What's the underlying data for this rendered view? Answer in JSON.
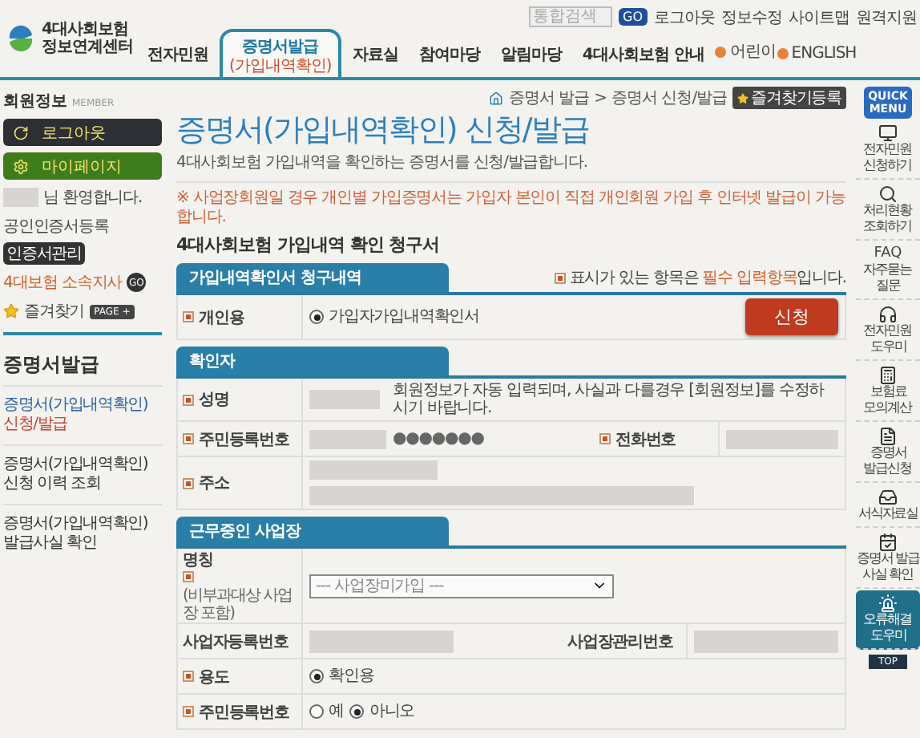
{
  "header": {
    "logo_lines": [
      "4대사회보험",
      "정보연계센터"
    ],
    "search": {
      "placeholder": "통합검색"
    },
    "go": "GO",
    "util_links": [
      "로그아웃",
      "정보수정",
      "사이트맵",
      "원격지원"
    ],
    "nav": [
      {
        "label": "전자민원",
        "selected": false
      },
      {
        "label": "증명서발급",
        "sub": "(가입내역확인)",
        "selected": true
      },
      {
        "label": "자료실",
        "selected": false
      },
      {
        "label": "참여마당",
        "selected": false
      },
      {
        "label": "알림마당",
        "selected": false
      },
      {
        "label": "4대사회보험 안내",
        "selected": false
      }
    ],
    "lang_links": [
      "어린이",
      "ENGLISH"
    ]
  },
  "sidebar": {
    "title": "회원정보",
    "title_en": "MEMBER",
    "logout": "로그아웃",
    "mypage": "마이페이지",
    "greeting": "님 환영합니다.",
    "cert_label": "공인인증서등록",
    "cert_button": "인증서관리",
    "branch": "4대보험 소속지사",
    "branch_go": "GO",
    "favorites": "즐겨찾기",
    "favorites_badge": "PAGE +",
    "section": "증명서발급",
    "menu": [
      {
        "lines": [
          "증명서(가입내역확인)",
          "신청/발급"
        ],
        "selected": true
      },
      {
        "lines": [
          "증명서(가입내역확인)",
          "신청 이력 조회"
        ],
        "selected": false
      },
      {
        "lines": [
          "증명서(가입내역확인)",
          "발급사실 확인"
        ],
        "selected": false
      }
    ]
  },
  "main": {
    "breadcrumb": [
      "증명서 발급",
      "증명서 신청/발급"
    ],
    "breadcrumb_separator": ">",
    "bookmark": "즐겨찾기등록",
    "title": "증명서(가입내역확인) 신청/발급",
    "subtitle": "4대사회보험 가입내역을 확인하는 증명서를 신청/발급합니다.",
    "notice": "※ 사업장회원일 경우 개인별 가입증명서는 가입자 본인이 직접 개인회원 가입 후 인터넷 발급이 가능합니다.",
    "form_title": "4대사회보험 가입내역 확인 청구서",
    "required_note": {
      "before": "표시가 있는 항목은 ",
      "highlight": "필수 입력항목",
      "after": "입니다."
    },
    "request": {
      "tab": "가입내역확인서 청구내역",
      "label": "개인용",
      "required": true,
      "option": {
        "label": "가입자가입내역확인서",
        "selected": true
      },
      "submit": "신청"
    },
    "confirmer": {
      "tab": "확인자",
      "name_label": "성명",
      "name_note": "회원정보가 자동 입력되며, 사실과 다를경우 [회원정보]를 수정하시기 바랍니다.",
      "rrn_label": "주민등록번호",
      "rrn_masked": "●●●●●●●",
      "phone_label": "전화번호",
      "address_label": "주소"
    },
    "workplace": {
      "tab": "근무중인 사업장",
      "name_label": "명칭",
      "name_sub": "(비부과대상 사업장 포함)",
      "select_value": "--- 사업장미가입 ---",
      "biz_label": "사업자등록번호",
      "biz_required": false,
      "mgmt_label": "사업장관리번호",
      "purpose_label": "용도",
      "purpose_options": [
        {
          "label": "확인용",
          "selected": true
        }
      ],
      "rrn_label": "주민등록번호",
      "rrn_options": [
        {
          "label": "예",
          "selected": false
        },
        {
          "label": "아니오",
          "selected": true
        }
      ]
    }
  },
  "quick_menu": {
    "title": [
      "QUICK",
      "MENU"
    ],
    "items": [
      {
        "lines": [
          "전자민원",
          "신청하기"
        ],
        "highlighted": false
      },
      {
        "lines": [
          "처리현황",
          "조회하기"
        ],
        "highlighted": false
      },
      {
        "head": "FAQ",
        "lines": [
          "자주묻는",
          "질문"
        ],
        "highlighted": false
      },
      {
        "lines": [
          "전자민원",
          "도우미"
        ],
        "highlighted": false
      },
      {
        "lines": [
          "보험료",
          "모의계산"
        ],
        "highlighted": false
      },
      {
        "lines": [
          "증명서",
          "발급신청"
        ],
        "highlighted": false
      },
      {
        "lines": [
          "서식자료실"
        ],
        "highlighted": false
      },
      {
        "lines": [
          "증명서 발급",
          "사실 확인"
        ],
        "highlighted": false
      },
      {
        "lines": [
          "오류해결",
          "도우미"
        ],
        "highlighted": true
      }
    ],
    "top": "TOP"
  }
}
